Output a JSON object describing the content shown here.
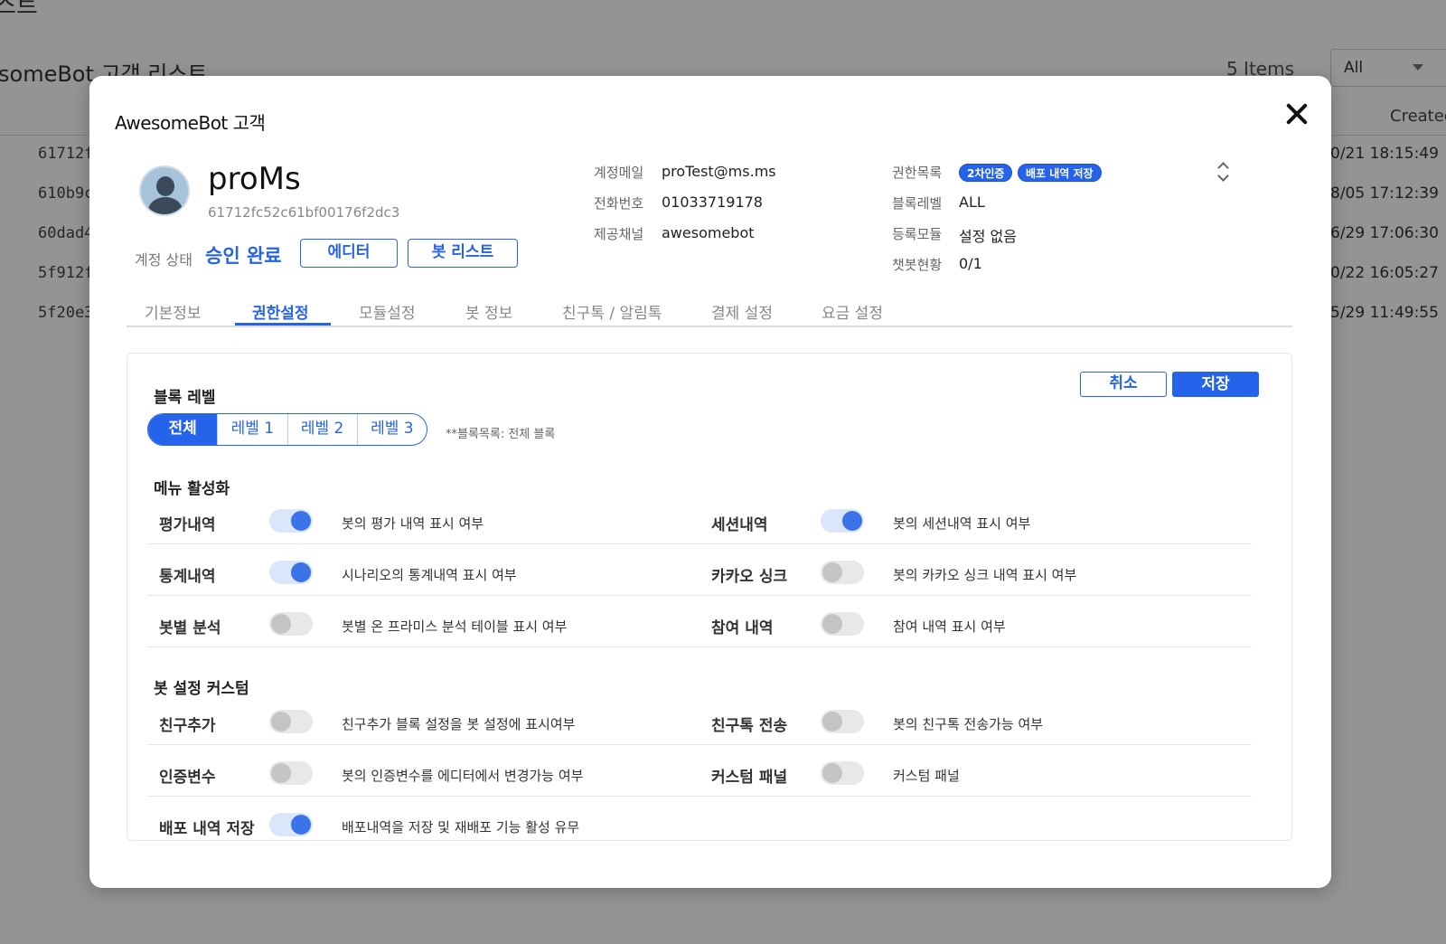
{
  "background": {
    "page_title": "스트",
    "list_title": "someBot 고객 리스트",
    "items_count": "5 Items",
    "filter_value": "All",
    "created_header": "Created",
    "rows": [
      {
        "id": "61712f",
        "date": "0/21 18:15:49"
      },
      {
        "id": "610b9c",
        "date": "8/05 17:12:39"
      },
      {
        "id": "60dad4",
        "date": "6/29 17:06:30"
      },
      {
        "id": "5f912f",
        "date": "0/22 16:05:27"
      },
      {
        "id": "5f20e3",
        "date": "5/29 11:49:55"
      }
    ]
  },
  "modal": {
    "title": "AwesomeBot 고객",
    "user": {
      "name": "proMs",
      "id": "61712fc52c61bf00176f2dc3"
    },
    "status": {
      "label": "계정 상태",
      "value": "승인 완료",
      "editor_btn": "에디터",
      "botlist_btn": "봇 리스트"
    },
    "info": {
      "email_label": "계정메일",
      "email": "proTest@ms.ms",
      "phone_label": "전화번호",
      "phone": "01033719178",
      "channel_label": "제공채널",
      "channel": "awesomebot",
      "perm_label": "권한목록",
      "perm_badges": [
        "2차인증",
        "배포 내역 저장"
      ],
      "block_label": "블록레벨",
      "block": "ALL",
      "module_label": "등록모듈",
      "module": "설정 없음",
      "chatbot_label": "챗봇현황",
      "chatbot": "0/1"
    },
    "tabs": [
      "기본정보",
      "권한설정",
      "모듈설정",
      "봇 정보",
      "친구톡 / 알림톡",
      "결제 설정",
      "요금 설정"
    ],
    "active_tab": "권한설정",
    "actions": {
      "cancel": "취소",
      "save": "저장"
    },
    "block_level": {
      "title": "블록 레벨",
      "options": [
        "전체",
        "레벨 1",
        "레벨 2",
        "레벨 3"
      ],
      "selected": "전체",
      "note": "**블록목록: 전체 블록"
    },
    "menu_section": {
      "title": "메뉴 활성화",
      "rows": [
        {
          "left": {
            "label": "평가내역",
            "on": true,
            "desc": "봇의 평가 내역 표시 여부"
          },
          "right": {
            "label": "세션내역",
            "on": true,
            "desc": "봇의 세션내역 표시 여부"
          }
        },
        {
          "left": {
            "label": "통계내역",
            "on": true,
            "desc": "시나리오의 통계내역 표시 여부"
          },
          "right": {
            "label": "카카오 싱크",
            "on": false,
            "desc": "봇의 카카오 싱크 내역 표시 여부"
          }
        },
        {
          "left": {
            "label": "봇별 분석",
            "on": false,
            "desc": "봇별 온 프라미스 분석 테이블 표시 여부"
          },
          "right": {
            "label": "참여 내역",
            "on": false,
            "desc": "참여 내역 표시 여부"
          }
        }
      ]
    },
    "bot_section": {
      "title": "봇 설정 커스텀",
      "rows": [
        {
          "left": {
            "label": "친구추가",
            "on": false,
            "desc": "친구추가 블록 설정을 봇 설정에 표시여부"
          },
          "right": {
            "label": "친구톡 전송",
            "on": false,
            "desc": "봇의 친구톡 전송가능 여부"
          }
        },
        {
          "left": {
            "label": "인증변수",
            "on": false,
            "desc": "봇의 인증변수를 에디터에서 변경가능 여부"
          },
          "right": {
            "label": "커스텀 패널",
            "on": false,
            "desc": "커스텀 패널"
          }
        },
        {
          "left": {
            "label": "배포 내역 저장",
            "on": true,
            "desc": "배포내역을 저장 및 재배포 기능 활성 유무"
          }
        }
      ]
    }
  }
}
